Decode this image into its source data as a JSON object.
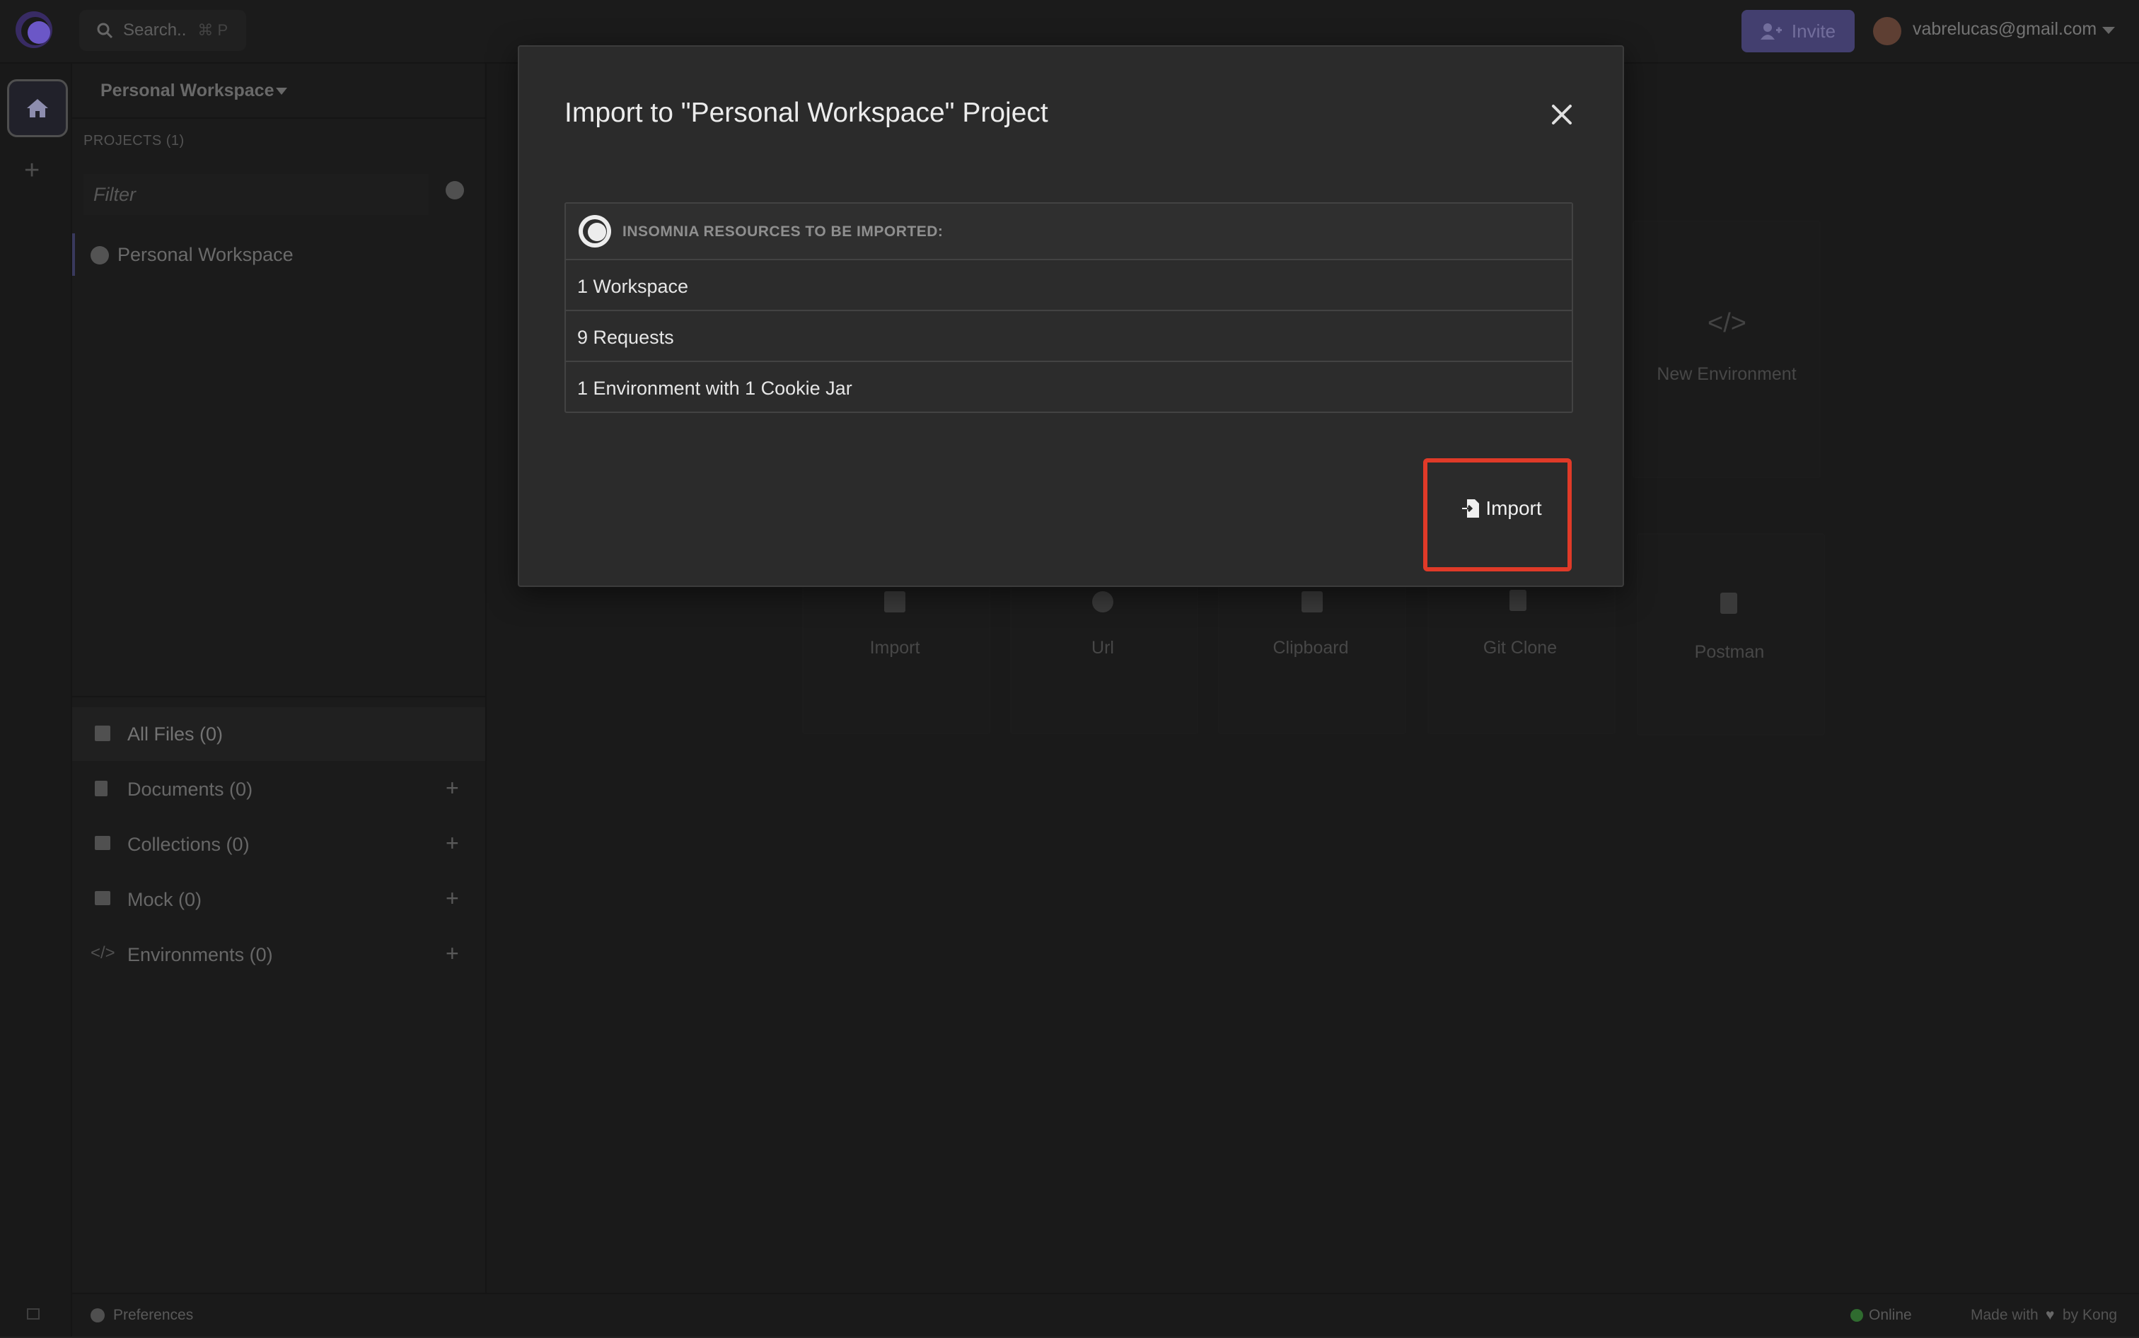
{
  "topbar": {
    "search_placeholder": "Search..",
    "search_shortcut": "⌘ P",
    "invite_label": "Invite",
    "user_email": "vabrelucas@gmail.com"
  },
  "sidebar": {
    "workspace_title": "Personal Workspace",
    "projects_label": "PROJECTS (1)",
    "filter_placeholder": "Filter",
    "project_item": "Personal Workspace",
    "nav": [
      {
        "label": "All Files (0)"
      },
      {
        "label": "Documents (0)"
      },
      {
        "label": "Collections (0)"
      },
      {
        "label": "Mock (0)"
      },
      {
        "label": "Environments (0)"
      }
    ],
    "preferences_label": "Preferences"
  },
  "background": {
    "new_environment_label": "New Environment",
    "import_cards": [
      {
        "label": "Import"
      },
      {
        "label": "Url"
      },
      {
        "label": "Clipboard"
      },
      {
        "label": "Git Clone"
      },
      {
        "label": "Postman"
      }
    ]
  },
  "status": {
    "online": "Online",
    "made_with": "Made with",
    "by_kong": "by Kong"
  },
  "modal": {
    "title": "Import to \"Personal Workspace\" Project",
    "resources_header": "INSOMNIA RESOURCES TO BE IMPORTED:",
    "resources": [
      {
        "text": "1 Workspace"
      },
      {
        "text": "9 Requests"
      },
      {
        "text": "1 Environment with 1 Cookie Jar"
      }
    ],
    "import_label": "Import"
  },
  "colors": {
    "highlight": "#e03a28",
    "accent": "#5a5494",
    "online": "#3f8f3f"
  }
}
